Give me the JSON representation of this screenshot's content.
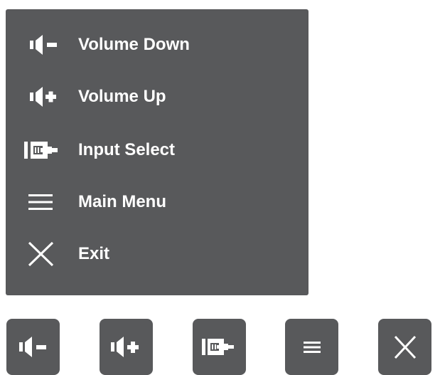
{
  "menu": {
    "items": [
      {
        "label": "Volume Down",
        "icon": "volume-down-icon"
      },
      {
        "label": "Volume Up",
        "icon": "volume-up-icon"
      },
      {
        "label": "Input Select",
        "icon": "input-select-icon"
      },
      {
        "label": "Main Menu",
        "icon": "menu-icon"
      },
      {
        "label": "Exit",
        "icon": "close-icon"
      }
    ]
  },
  "keys": [
    {
      "icon": "volume-down-icon"
    },
    {
      "icon": "volume-up-icon"
    },
    {
      "icon": "input-select-icon"
    },
    {
      "icon": "menu-icon"
    },
    {
      "icon": "close-icon"
    }
  ],
  "colors": {
    "panel": "#58595b",
    "foreground": "#ffffff"
  }
}
